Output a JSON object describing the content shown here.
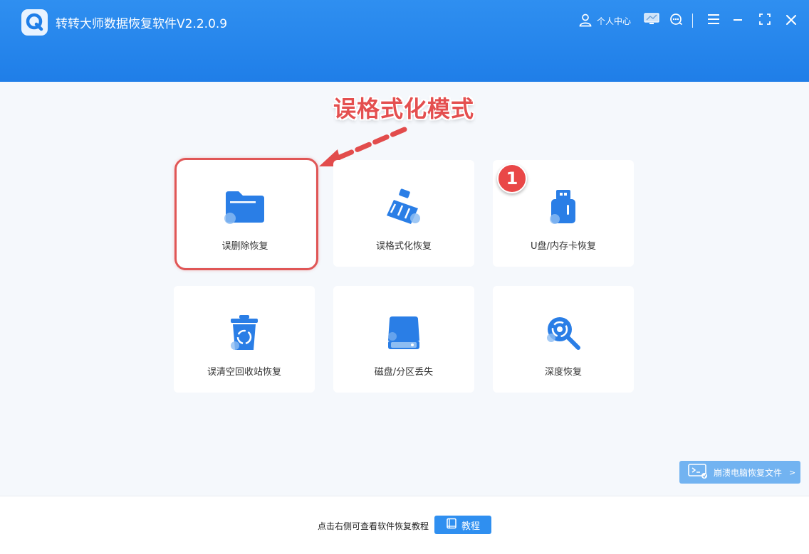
{
  "app": {
    "title": "转转大师数据恢复软件V2.2.0.9"
  },
  "titlebar": {
    "user_center_label": "个人中心"
  },
  "annotation": {
    "callout_text": "误格式化模式",
    "step_number": "1",
    "highlight_color": "#e05656"
  },
  "modes": [
    {
      "label": "误删除恢复",
      "icon": "folder-icon"
    },
    {
      "label": "误格式化恢复",
      "icon": "broom-icon"
    },
    {
      "label": "U盘/内存卡恢复",
      "icon": "usb-drive-icon"
    },
    {
      "label": "误清空回收站恢复",
      "icon": "recycle-bin-icon"
    },
    {
      "label": "磁盘/分区丢失",
      "icon": "hard-disk-icon"
    },
    {
      "label": "深度恢复",
      "icon": "deep-scan-icon"
    }
  ],
  "side_button": {
    "label": "崩溃电脑恢复文件",
    "chevron": ">"
  },
  "footer": {
    "hint": "点击右侧可查看软件恢复教程",
    "tutorial_label": "教程"
  },
  "colors": {
    "brand_blue": "#2f8ff0",
    "accent_red": "#e94747",
    "background": "#f5f8fc"
  }
}
